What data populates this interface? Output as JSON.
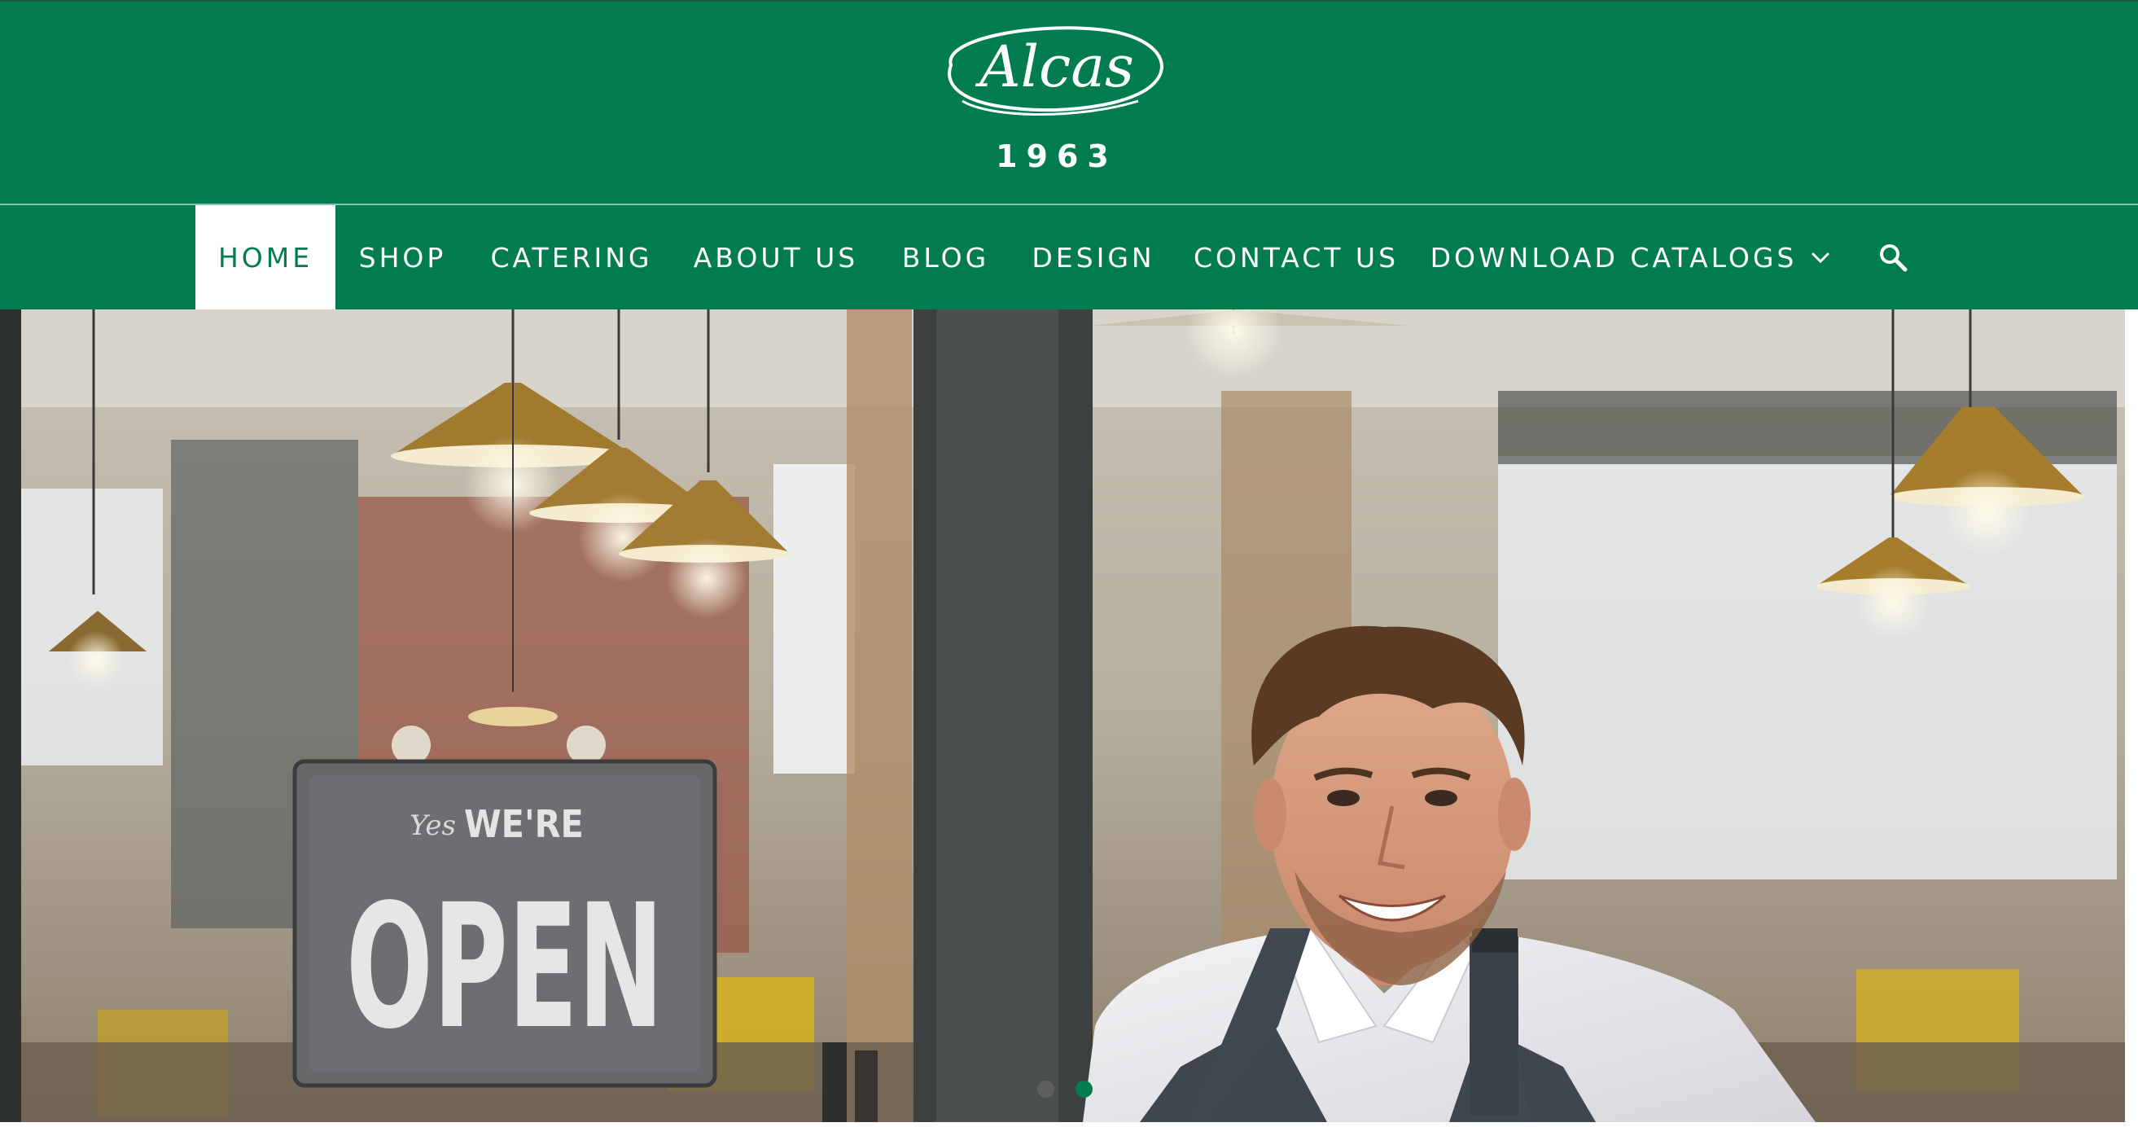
{
  "brand": {
    "logo_text": "Alcas",
    "year": "1963"
  },
  "colors": {
    "brand_green": "#017c4f",
    "nav_text": "#ffffff",
    "active_text": "#017c4f",
    "dot_inactive": "#5f5f5f",
    "dot_active": "#017c4f"
  },
  "nav": {
    "items": [
      {
        "label": "HOME",
        "active": true
      },
      {
        "label": "SHOP"
      },
      {
        "label": "CATERING"
      },
      {
        "label": "ABOUT US"
      },
      {
        "label": "BLOG"
      },
      {
        "label": "DESIGN"
      },
      {
        "label": "CONTACT US"
      },
      {
        "label": "DOWNLOAD CATALOGS",
        "icon": "chevron-down-icon"
      }
    ],
    "search_icon": "search-icon"
  },
  "hero": {
    "sign": {
      "small": "Yes",
      "mid": "WE'RE",
      "big": "OPEN"
    },
    "slides_count": 2,
    "active_slide": 2
  }
}
